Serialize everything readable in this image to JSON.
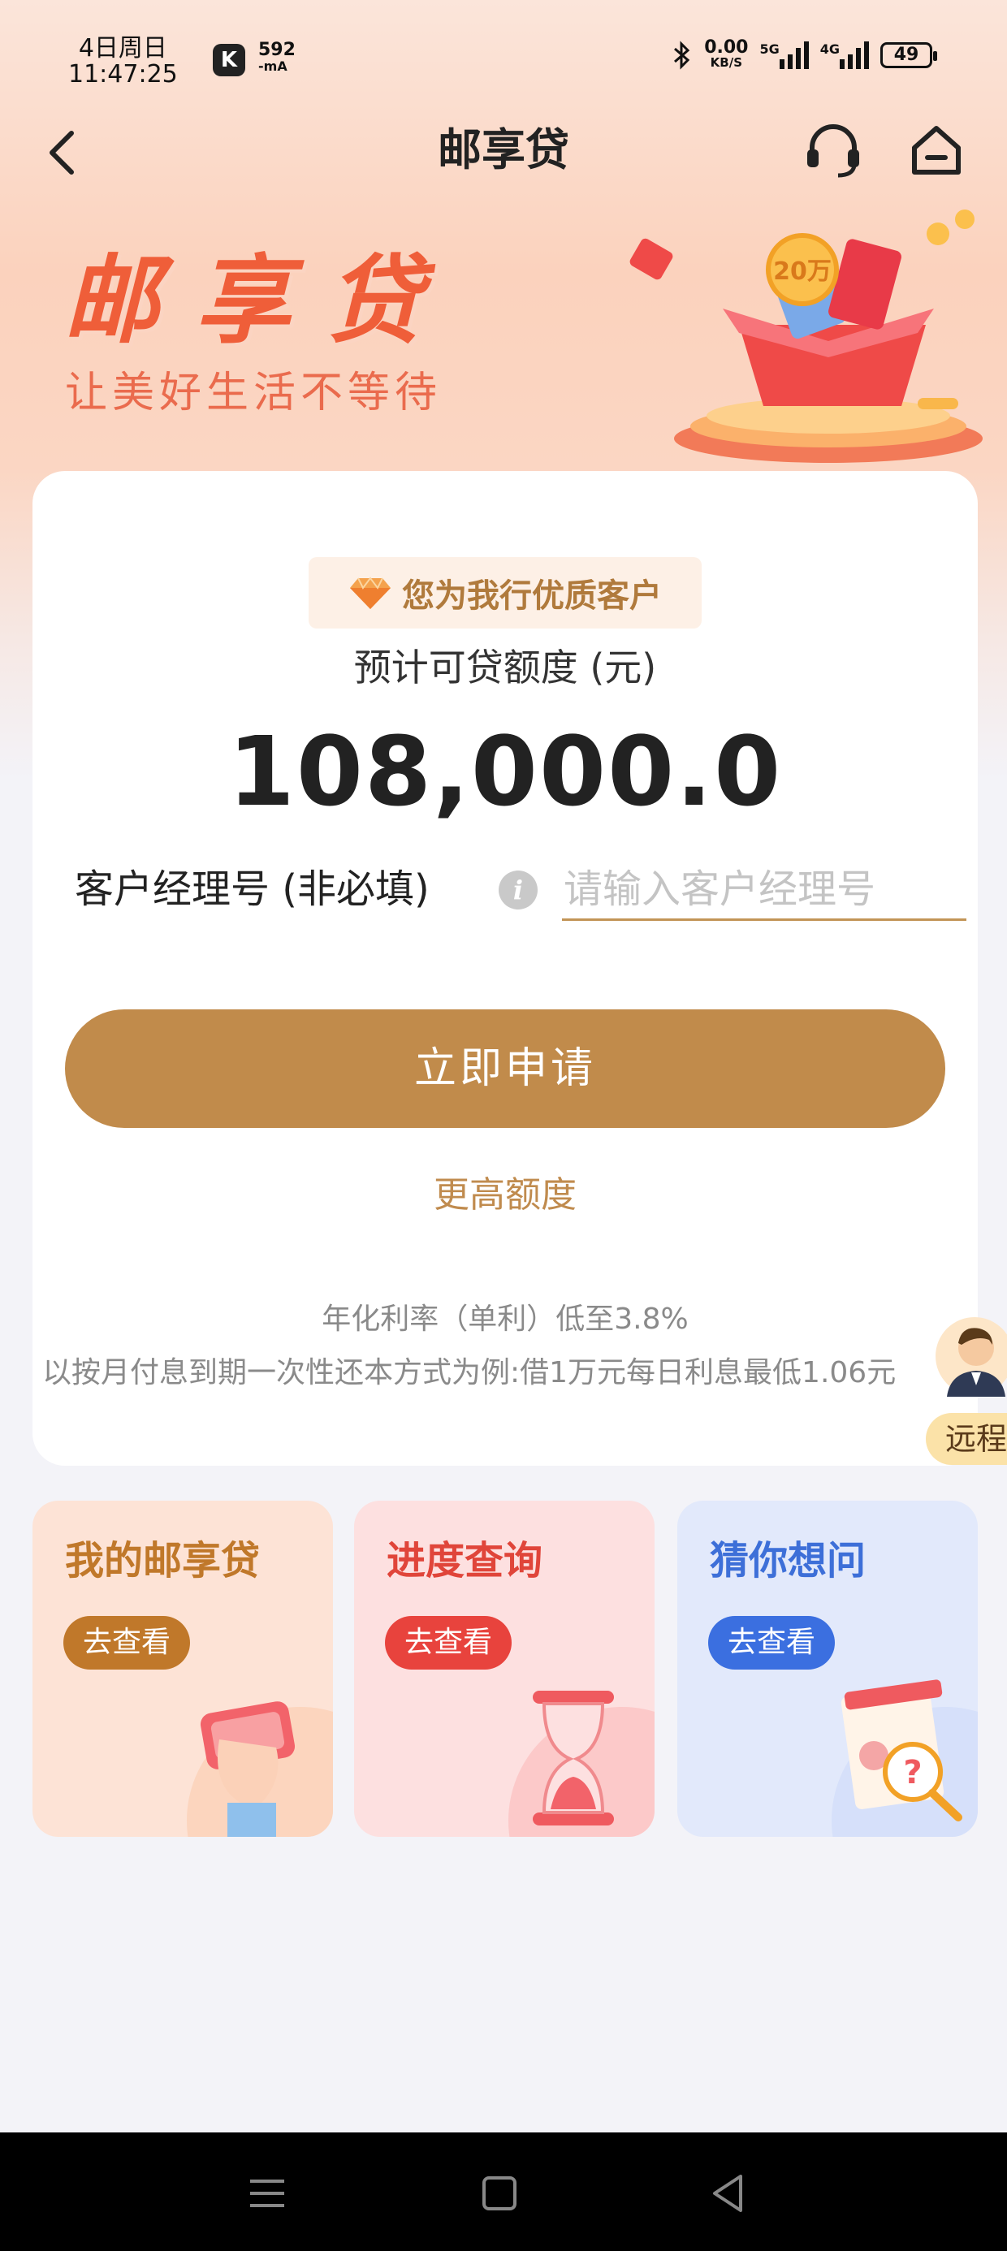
{
  "status_bar": {
    "date": "4日周日",
    "time": "11:47:25",
    "app_icon_glyph": "K",
    "current_value": "592",
    "current_unit": "-mA",
    "net_speed": "0.00",
    "net_unit": "KB/S",
    "net_5g": "5G",
    "net_4g": "4G",
    "battery": "49"
  },
  "nav": {
    "title": "邮享贷",
    "back_icon": "chevron-left-icon",
    "service_icon": "headset-icon",
    "home_icon": "home-icon"
  },
  "banner": {
    "title": "邮享贷",
    "subtitle": "让美好生活不等待",
    "coin_label": "20万"
  },
  "loan_card": {
    "badge_text": "您为我行优质客户",
    "estimate_label": "预计可贷额度 (元)",
    "amount": "108,000.0",
    "manager_label": "客户经理号 (非必填)",
    "manager_input_value": "",
    "manager_input_placeholder": "请输入客户经理号",
    "apply_button": "立即申请",
    "higher_limit_link": "更高额度",
    "rate_text": "年化利率（单利）低至3.8%",
    "rate_example": "以按月付息到期一次性还本方式为例:借1万元每日利息最低1.06元"
  },
  "remote_service": {
    "label": "远程"
  },
  "tiles": [
    {
      "title": "我的邮享贷",
      "button": "去查看",
      "title_color": "#c0782a",
      "button_color": "#c0782a",
      "bg": "#fde3d6"
    },
    {
      "title": "进度查询",
      "button": "去查看",
      "title_color": "#e0453a",
      "button_color": "#e8433d",
      "bg": "#fde0e0"
    },
    {
      "title": "猜你想问",
      "button": "去查看",
      "title_color": "#3d6fd8",
      "button_color": "#3b6fe0",
      "bg": "#e2e9fb"
    }
  ],
  "colors": {
    "accent": "#c18b4b",
    "banner_title": "#ef5e39"
  }
}
